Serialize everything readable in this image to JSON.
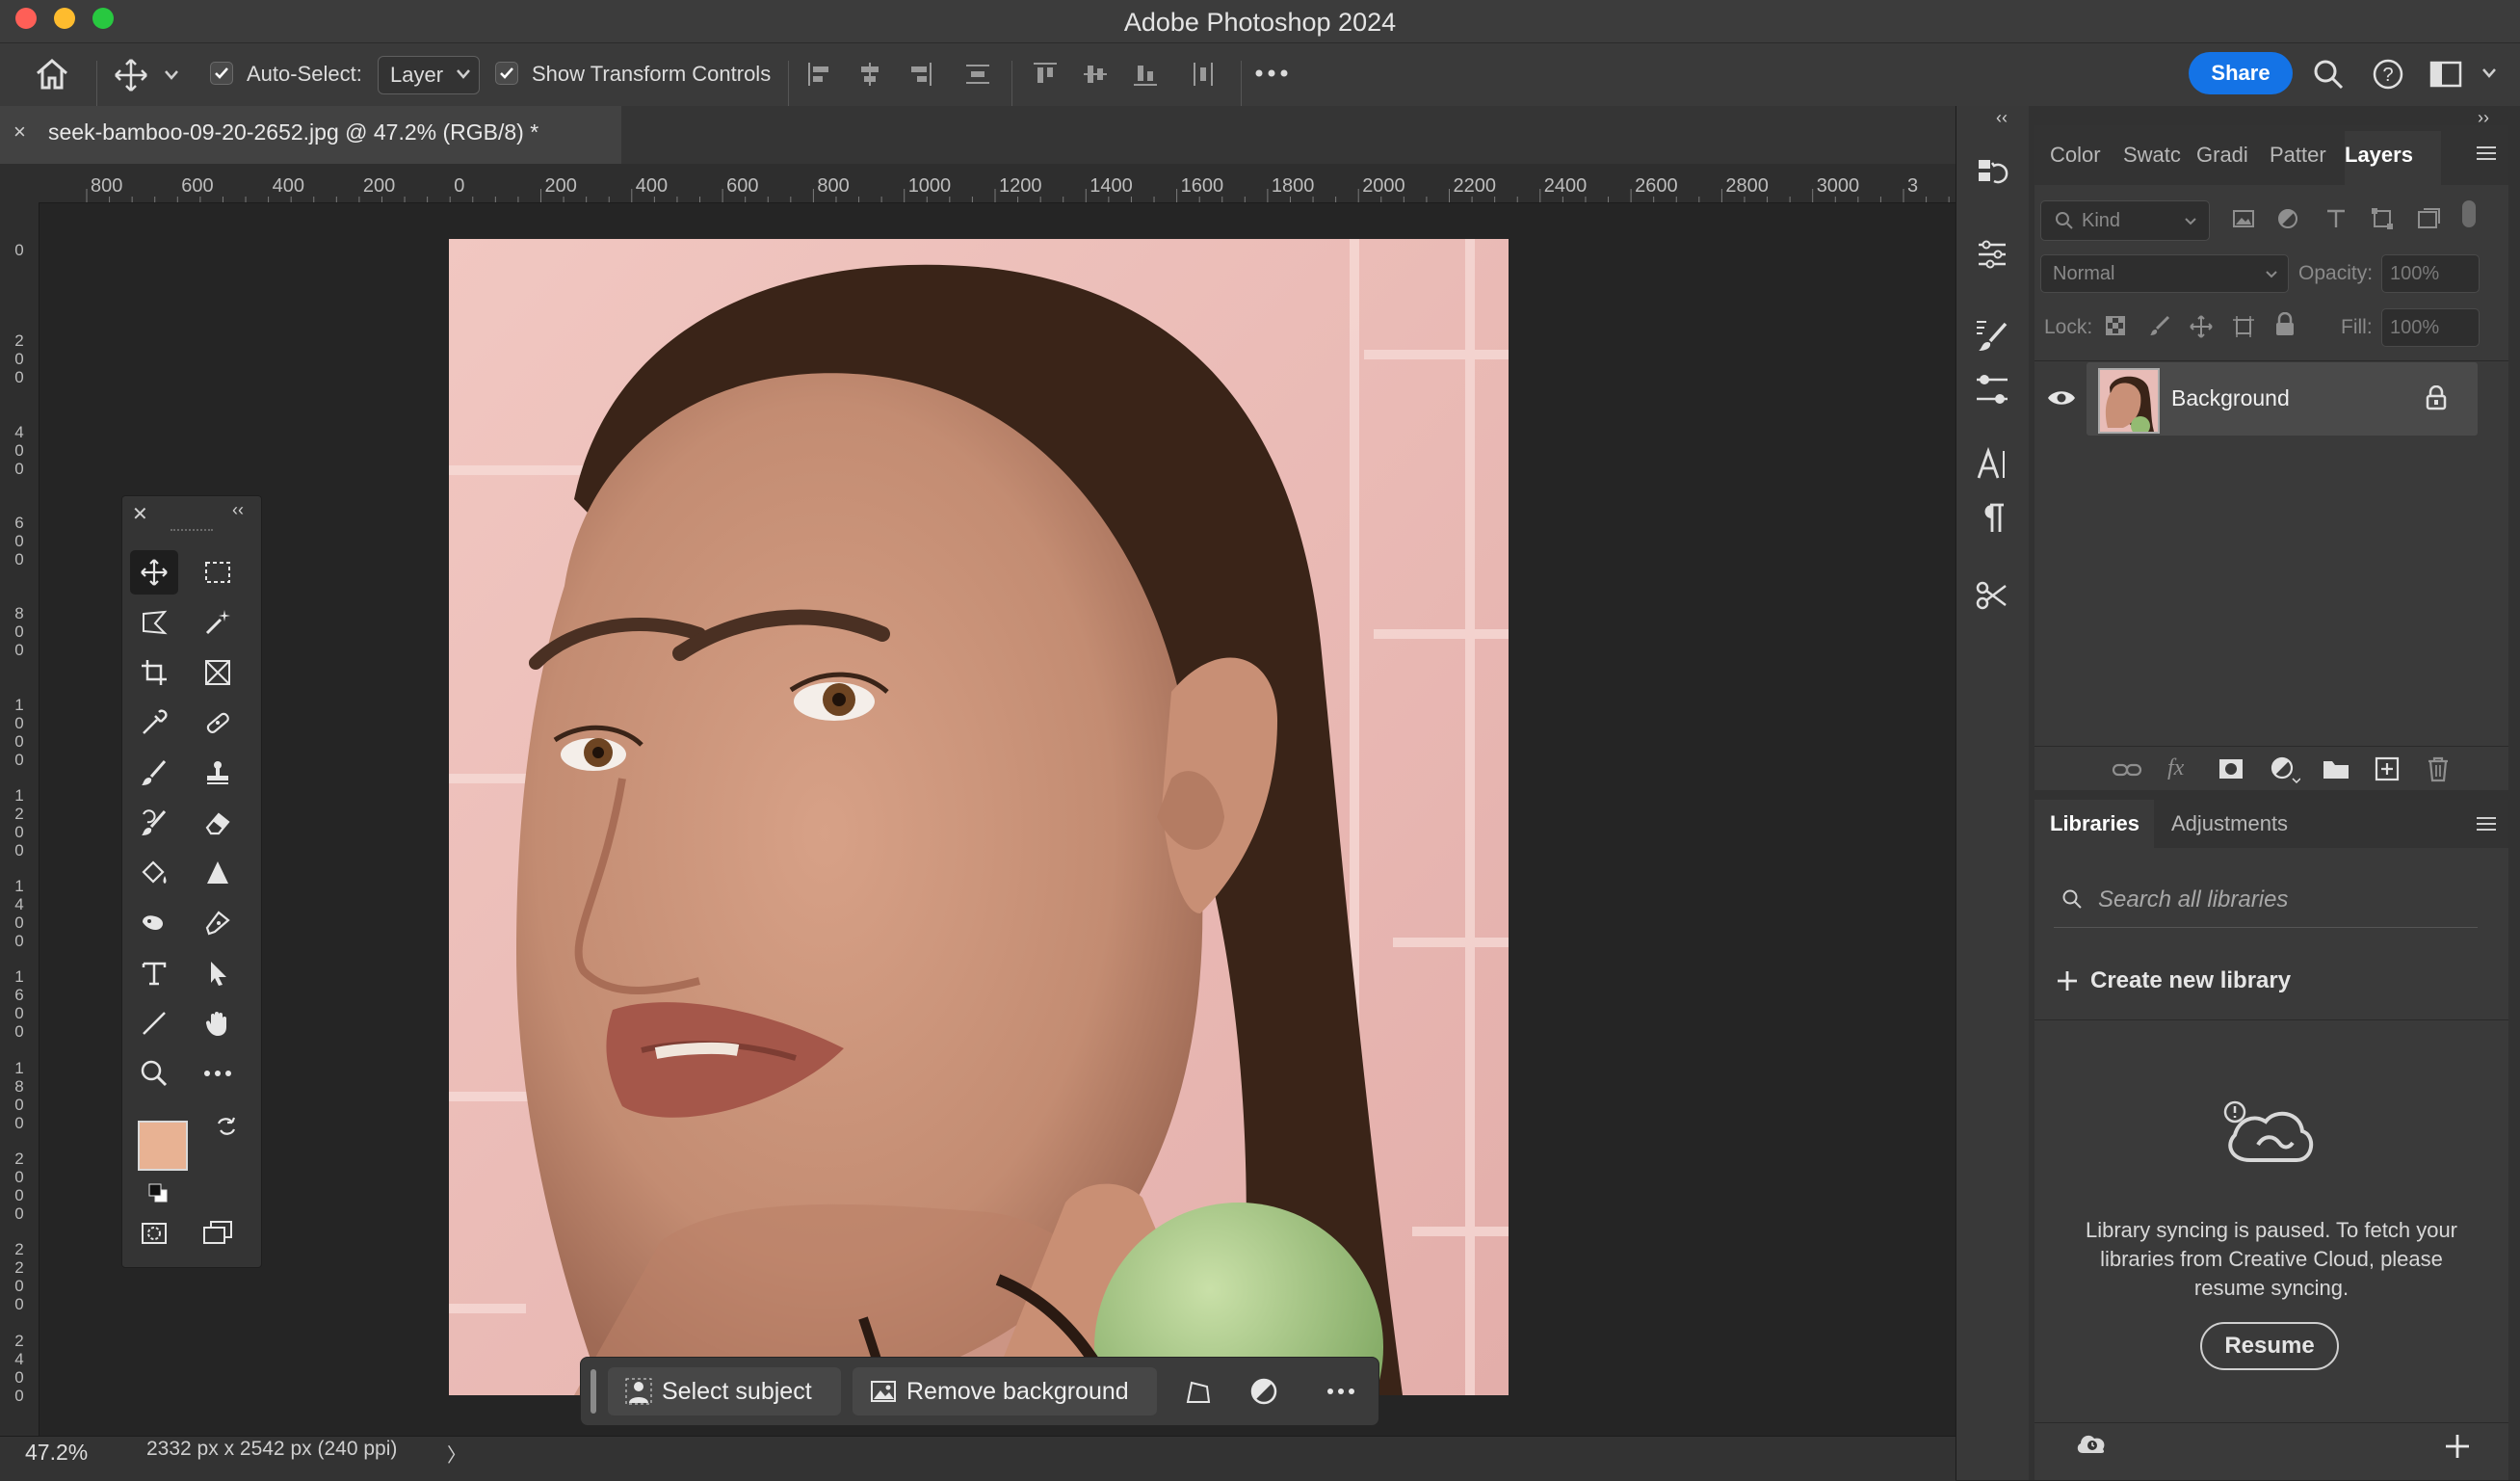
{
  "window": {
    "title": "Adobe Photoshop 2024"
  },
  "options_bar": {
    "auto_select_label": "Auto-Select:",
    "auto_select_value": "Layer",
    "show_transform_label": "Show Transform Controls",
    "share_label": "Share"
  },
  "document": {
    "tab_close": "×",
    "tab_title": "seek-bamboo-09-20-2652.jpg @ 47.2% (RGB/8) *"
  },
  "rulers": {
    "horizontal": [
      "800",
      "600",
      "400",
      "200",
      "0",
      "200",
      "400",
      "600",
      "800",
      "1000",
      "1200",
      "1400",
      "1600",
      "1800",
      "2000",
      "2200",
      "2400",
      "2600",
      "2800",
      "3000",
      "3"
    ],
    "vertical": [
      "0",
      "2 0 0",
      "4 0 0",
      "6 0 0",
      "8 0 0",
      "1 0 0 0",
      "1 2 0 0",
      "1 4 0 0",
      "1 6 0 0",
      "1 8 0 0",
      "2 0 0 0",
      "2 2 0 0",
      "2 4 0 0"
    ]
  },
  "taskbar": {
    "select_subject": "Select subject",
    "remove_background": "Remove background"
  },
  "status": {
    "zoom": "47.2%",
    "doc_size": "2332 px x 2542 px (240 ppi)",
    "arrow": "〉"
  },
  "panels": {
    "tabs": [
      "Color",
      "Swatc",
      "Gradi",
      "Patter",
      "Layers"
    ],
    "kind_placeholder": "Kind",
    "blend_mode": "Normal",
    "opacity_label": "Opacity:",
    "opacity_value": "100%",
    "lock_label": "Lock:",
    "fill_label": "Fill:",
    "fill_value": "100%",
    "layer_name": "Background",
    "lib_tabs": [
      "Libraries",
      "Adjustments"
    ],
    "search_placeholder": "Search all libraries",
    "create_library": "Create new library",
    "sync_message": "Library syncing is paused. To fetch your libraries from Creative Cloud, please resume syncing.",
    "resume_label": "Resume"
  },
  "colors": {
    "foreground": "#e8b293",
    "background": "#ffffff",
    "accent": "#1473e6"
  }
}
